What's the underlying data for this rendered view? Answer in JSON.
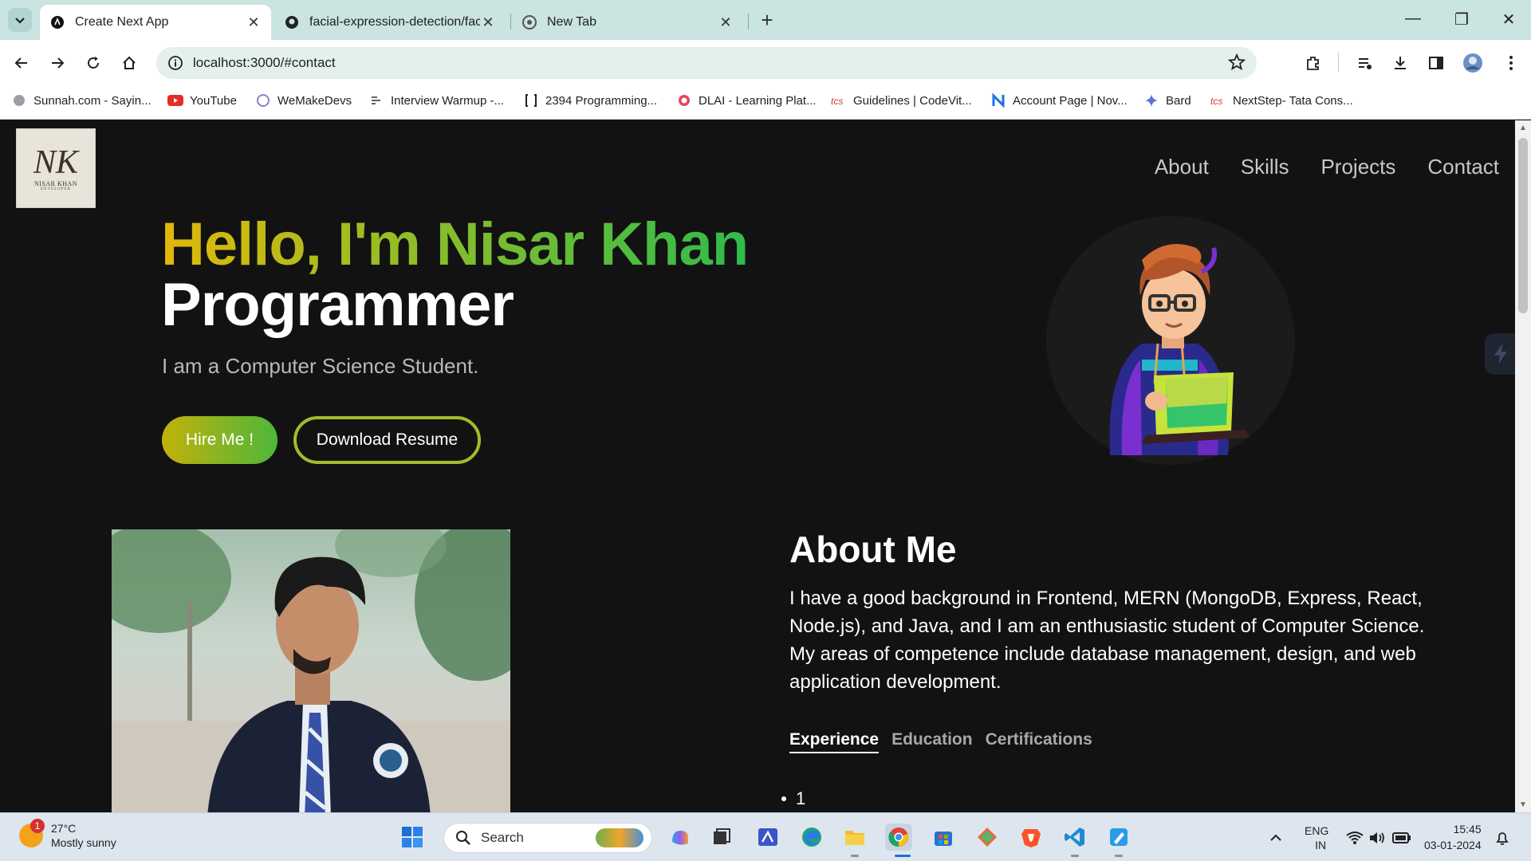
{
  "browser": {
    "tabs": [
      {
        "label": "Create Next App",
        "active": true
      },
      {
        "label": "facial-expression-detection/fac",
        "active": false
      },
      {
        "label": "New Tab",
        "active": false
      }
    ],
    "url": "localhost:3000/#contact",
    "bookmarks": [
      "Sunnah.com - Sayin...",
      "YouTube",
      "WeMakeDevs",
      "Interview Warmup -...",
      "2394 Programming...",
      "DLAI - Learning Plat...",
      "Guidelines | CodeVit...",
      "Account Page | Nov...",
      "Bard",
      "NextStep- Tata Cons..."
    ]
  },
  "site": {
    "logo": {
      "monogram": "NK",
      "name": "NISAR KHAN",
      "sub": "DEVELOPER"
    },
    "nav": [
      "About",
      "Skills",
      "Projects",
      "Contact"
    ],
    "hero": {
      "greeting": "Hello, I'm Nisar Khan",
      "role": "Programmer",
      "subtitle": "I am a Computer Science Student.",
      "hire_button": "Hire Me !",
      "resume_button": "Download Resume"
    },
    "about": {
      "title": "About Me",
      "text": "I have a good background in Frontend, MERN (MongoDB, Express, React, Node.js), and Java, and I am an enthusiastic student of Computer Science. My areas of competence include database management, design, and web application development.",
      "tabs": [
        "Experience",
        "Education",
        "Certifications"
      ],
      "active_tab": "Experience",
      "list_items": [
        "1"
      ]
    }
  },
  "taskbar": {
    "weather_temp": "27°C",
    "weather_desc": "Mostly sunny",
    "weather_badge": "1",
    "search_placeholder": "Search",
    "lang_line1": "ENG",
    "lang_line2": "IN",
    "time": "15:45",
    "date": "03-01-2024"
  },
  "colors": {
    "page_bg": "#121212",
    "gradient_start": "#e3b80a",
    "gradient_end": "#2fbb4c",
    "tabbar_bg": "#c9e4e1"
  }
}
